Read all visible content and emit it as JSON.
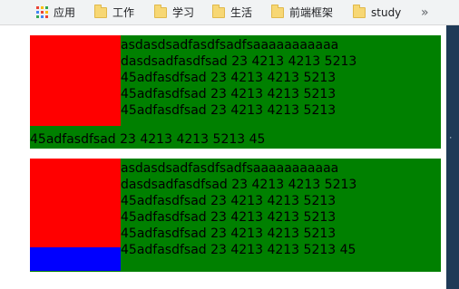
{
  "bookmarks": {
    "apps_label": "应用",
    "folders": [
      "工作",
      "学习",
      "生活",
      "前端框架",
      "study"
    ],
    "more_icon": "chevron-double-right-icon"
  },
  "demo1": {
    "lines": [
      "asdasdsadfasdfsadfsaaaaaaaaaaa",
      "dasdsadfasdfsad 23 4213 4213 5213",
      "45adfasdfsad 23 4213 4213 5213",
      "45adfasdfsad 23 4213 4213 5213",
      "45adfasdfsad 23 4213 4213 5213",
      "45adfasdfsad 23 4213 4213 5213 45"
    ]
  },
  "demo2": {
    "lines": [
      "asdasdsadfasdfsadfsaaaaaaaaaaa",
      "dasdsadfasdfsad 23 4213 4213 5213",
      "45adfasdfsad 23 4213 4213 5213",
      "45adfasdfsad 23 4213 4213 5213",
      "45adfasdfsad 23 4213 4213 5213",
      "45adfasdfsad 23 4213 4213 5213 45"
    ]
  },
  "colors": {
    "green": "#008000",
    "red": "#ff0000",
    "blue": "#0000ff",
    "bookmarks_bg": "#f1f3f4"
  }
}
